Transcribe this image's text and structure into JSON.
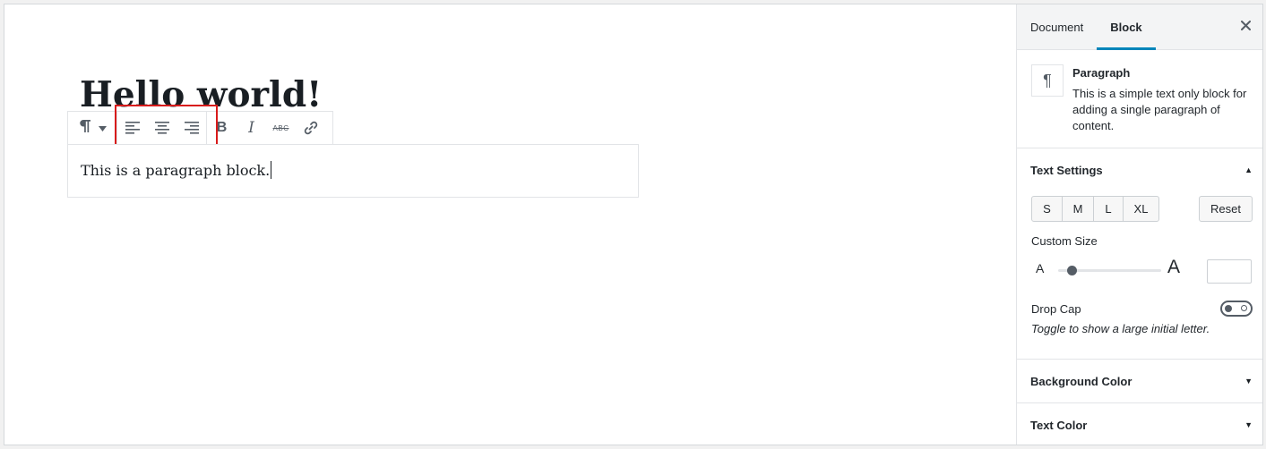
{
  "editor": {
    "post_title": "Hello world!",
    "paragraph_text": "This is a paragraph block.",
    "toolbar": {
      "block_switcher_icon": "paragraph-icon",
      "block_switcher_arrow_icon": "caret-down-icon",
      "align_buttons": [
        "align-left-icon",
        "align-center-icon",
        "align-right-icon"
      ],
      "format_buttons": {
        "bold_glyph": "B",
        "italic_glyph": "I",
        "strikethrough_glyph": "ABC",
        "link_icon": "link-icon"
      }
    },
    "highlight_color": "#d81b1b"
  },
  "sidebar": {
    "tabs": [
      {
        "label": "Document",
        "active": false
      },
      {
        "label": "Block",
        "active": true
      }
    ],
    "close_glyph": "✕",
    "block_card": {
      "icon_glyph": "¶",
      "title": "Paragraph",
      "description": "This is a simple text only block for adding a single paragraph of content."
    },
    "text_settings": {
      "title": "Text Settings",
      "expanded": true,
      "sizes": [
        "S",
        "M",
        "L",
        "XL"
      ],
      "reset_label": "Reset",
      "custom_size_label": "Custom Size",
      "small_a": "A",
      "large_a": "A",
      "slider_value": 0.1,
      "custom_size_value": "",
      "drop_cap_label": "Drop Cap",
      "drop_cap_enabled": false,
      "drop_cap_help": "Toggle to show a large initial letter."
    },
    "background_color": {
      "title": "Background Color",
      "expanded": false
    },
    "text_color": {
      "title": "Text Color",
      "expanded": false
    }
  },
  "colors": {
    "accent": "#0085ba",
    "text": "#23282d",
    "border": "#e2e4e7"
  }
}
